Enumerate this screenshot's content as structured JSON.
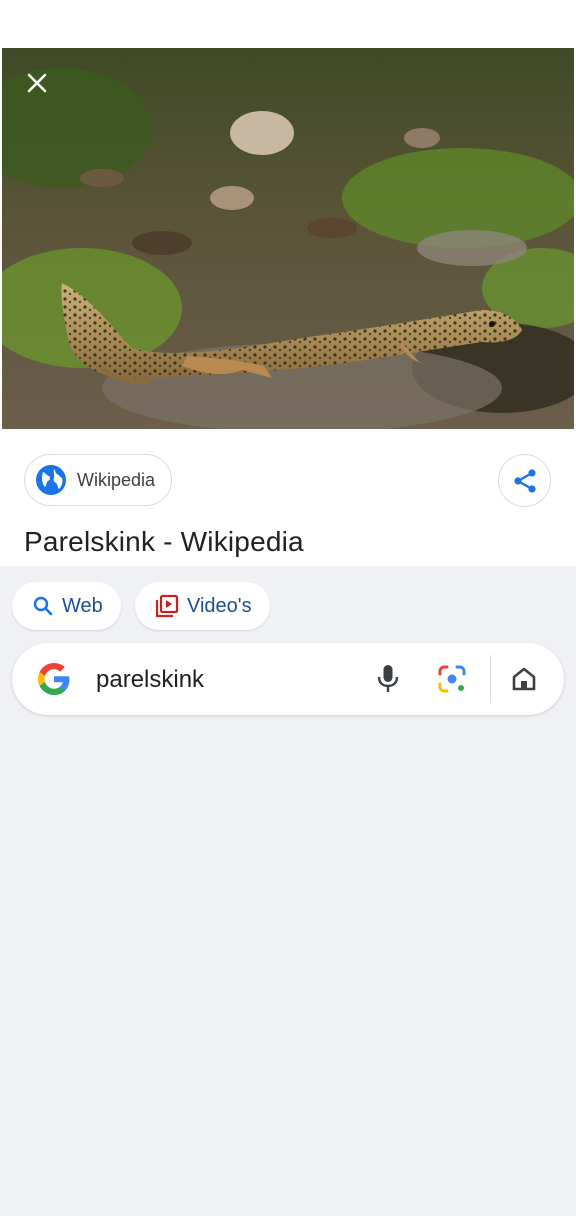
{
  "viewer": {
    "close_icon": "close-icon",
    "image_subject": "lizard"
  },
  "result": {
    "source_name": "Wikipedia",
    "source_icon": "globe-icon",
    "share_icon": "share-icon",
    "title": "Parelskink - Wikipedia"
  },
  "filters": [
    {
      "label": "Web",
      "icon": "search-icon"
    },
    {
      "label": "Video's",
      "icon": "video-library-icon"
    }
  ],
  "search": {
    "query": "parelskink",
    "logo": "google-g-logo",
    "voice_icon": "mic-icon",
    "lens_icon": "lens-icon",
    "home_icon": "home-icon"
  },
  "colors": {
    "panel_bg": "#f0f1f4",
    "chip_text": "#1f4e8c",
    "link_blue": "#1a73e8",
    "video_red": "#c5221f"
  }
}
